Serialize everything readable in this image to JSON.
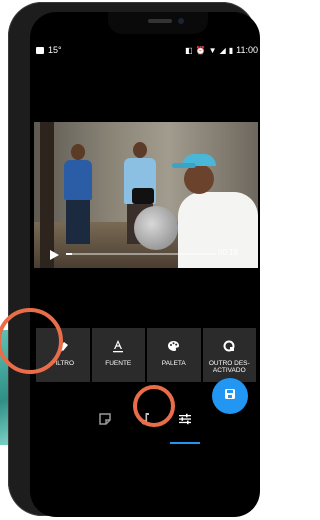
{
  "status_bar": {
    "temperature": "15°",
    "time": "11:00",
    "icons": [
      "image-icon",
      "vibrate-icon",
      "alarm-icon",
      "wifi-icon",
      "signal-icon",
      "battery-icon"
    ]
  },
  "video": {
    "time": "00:19",
    "progress": 0.04
  },
  "filters": [
    {
      "id": "filtro",
      "label": "FILTRO",
      "icon": "eraser-icon"
    },
    {
      "id": "fuente",
      "label": "FUENTE",
      "icon": "font-icon"
    },
    {
      "id": "paleta",
      "label": "PALETA",
      "icon": "palette-icon"
    },
    {
      "id": "outro",
      "label": "OUTRO DES-ACTIVADO",
      "icon": "outro-icon"
    }
  ],
  "fab": {
    "icon": "save-icon"
  },
  "bottom_tabs": [
    {
      "id": "sticker",
      "icon": "sticker-icon"
    },
    {
      "id": "music",
      "icon": "music-note-icon"
    },
    {
      "id": "adjust",
      "icon": "sliders-icon",
      "active": true
    }
  ],
  "colors": {
    "accent": "#2196f3",
    "highlight": "#ea6d4a",
    "toolbar_bg": "#2b2b2b"
  }
}
